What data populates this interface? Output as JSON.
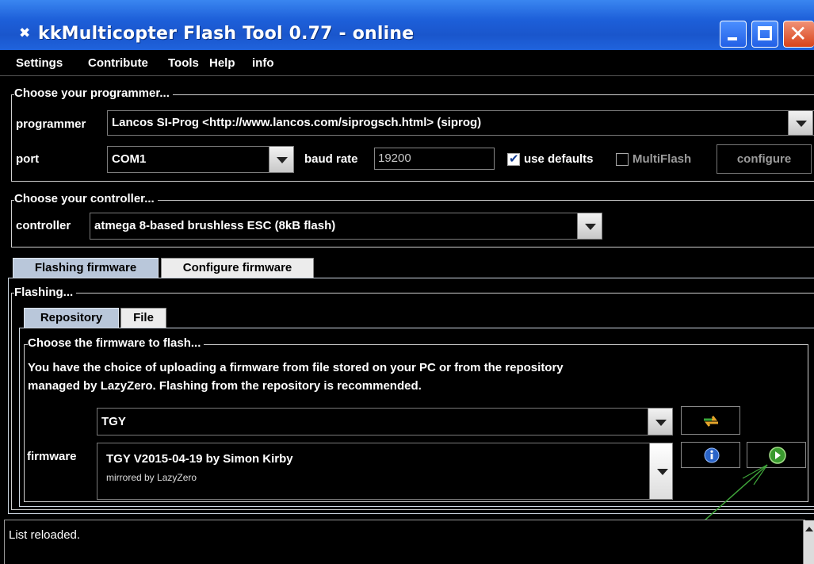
{
  "window": {
    "title": "kkMulticopter Flash Tool 0.77 - online"
  },
  "menu": [
    "Settings",
    "Contribute",
    "Tools",
    "Help",
    "info"
  ],
  "programmer_group": {
    "title": "Choose your programmer...",
    "programmer_label": "programmer",
    "programmer_value": "Lancos SI-Prog <http://www.lancos.com/siprogsch.html> (siprog)",
    "port_label": "port",
    "port_value": "COM1",
    "baud_label": "baud rate",
    "baud_value": "19200",
    "use_defaults_label": "use defaults",
    "use_defaults_checked": true,
    "multiflash_label": "MultiFlash",
    "multiflash_checked": false,
    "configure_label": "configure"
  },
  "controller_group": {
    "title": "Choose your controller...",
    "controller_label": "controller",
    "controller_value": "atmega 8-based brushless ESC (8kB flash)"
  },
  "main_tabs": [
    "Flashing firmware",
    "Configure firmware"
  ],
  "flashing": {
    "title": "Flashing...",
    "sub_tabs": [
      "Repository",
      "File"
    ],
    "choose_title": "Choose the firmware to flash...",
    "description_line1": "You have the choice of uploading a firmware from file stored on your PC or from the repository",
    "description_line2": "managed by LazyZero. Flashing from the repository is recommended.",
    "repo_value": "TGY",
    "firmware_label": "firmware",
    "firmware_name": "TGY V2015-04-19  by Simon Kirby",
    "firmware_sub": "mirrored by LazyZero"
  },
  "icons": {
    "reload": "reload-icon",
    "info": "info-icon",
    "flash": "flash-go-icon"
  },
  "colors": {
    "title_bar": "#1d5fd9",
    "close_button": "#d8431a",
    "tab_active": "#b9c7da",
    "annotation_arrow": "#3fa53a"
  },
  "status": {
    "message": "List reloaded."
  }
}
